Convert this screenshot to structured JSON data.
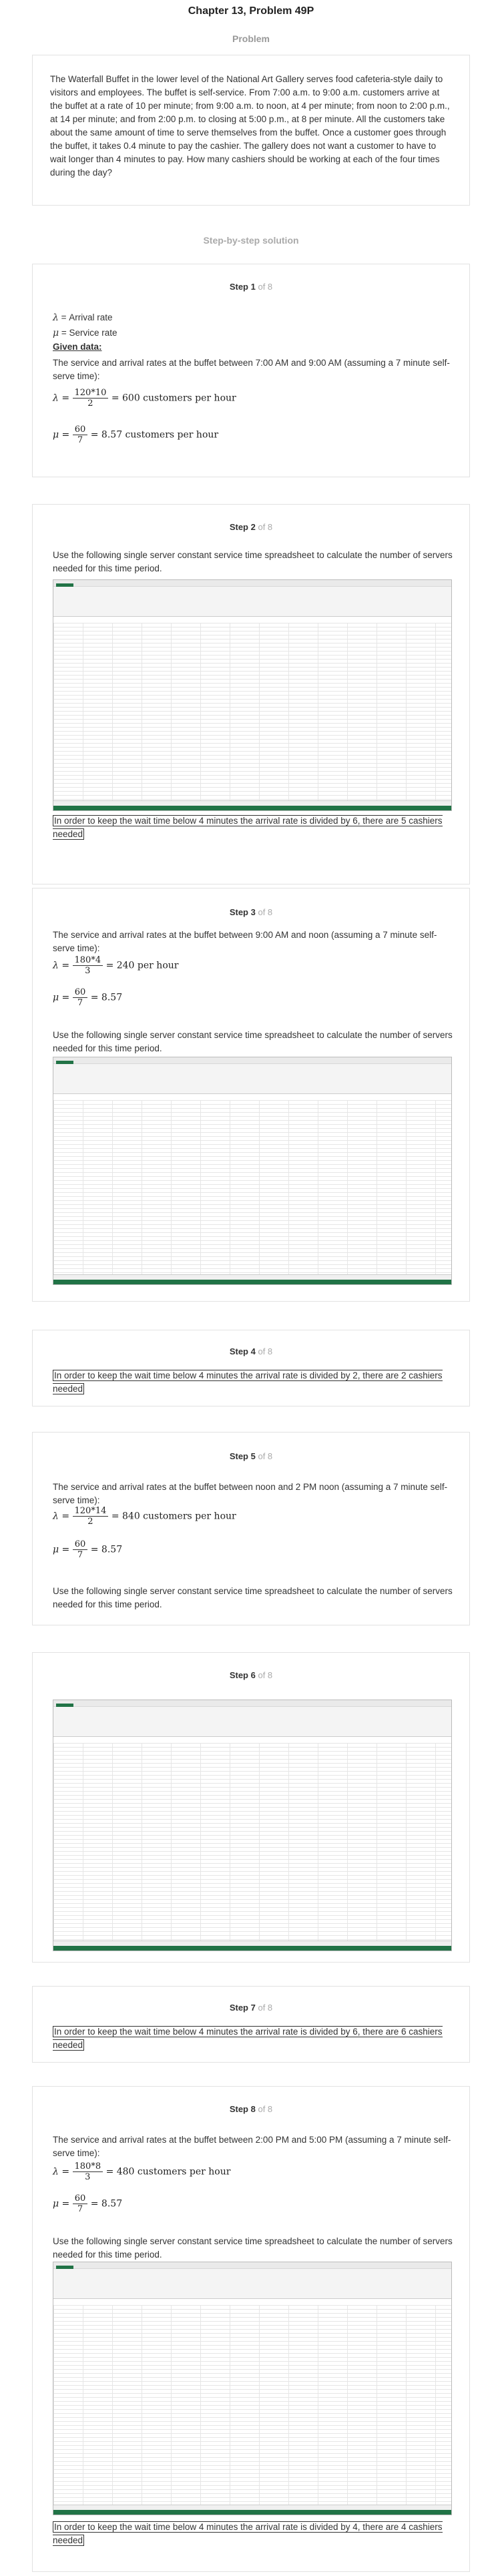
{
  "header": {
    "title": "Chapter 13, Problem 49P",
    "subtitle": "Problem"
  },
  "problem": {
    "text": "The Waterfall Buffet in the lower level of the National Art Gallery serves food cafeteria-style daily to visitors and employees. The buffet is self-service. From 7:00 a.m. to 9:00 a.m. customers arrive at the buffet at a rate of 10 per minute; from 9:00 a.m. to noon, at 4 per minute; from noon to 2:00 p.m., at 14 per minute; and from 2:00 p.m. to closing at 5:00 p.m., at 8 per minute. All the customers take about the same amount of time to serve themselves from the buffet. Once a customer goes through the buffet, it takes 0.4 minute to pay the cashier. The gallery does not want a customer to have to wait longer than 4 minutes to pay. How many cashiers should be working at each of the four times during the day?"
  },
  "solution_label": "Step-by-step solution",
  "of_label": "of 8",
  "steps": {
    "s1": {
      "label": "Step 1",
      "lambda_def": "= Arrival rate",
      "mu_def": "= Service rate",
      "given": "Given data:",
      "text": "The service and arrival rates at the buffet between 7:00 AM and 9:00 AM (assuming a 7 minute self-serve time):",
      "l_num": "120*10",
      "l_den": "2",
      "l_res": "= 600 customers per hour",
      "m_num": "60",
      "m_den": "7",
      "m_res": "= 8.57 customers per hour"
    },
    "s2": {
      "label": "Step 2",
      "text": "Use the following single server constant service time spreadsheet to calculate the number of servers needed for this time period.",
      "answer": "In order to keep the wait time below 4 minutes the arrival rate is divided by 6, there are 5 cashiers needed"
    },
    "s3": {
      "label": "Step 3",
      "text": "The service and arrival rates at the buffet between 9:00 AM and noon (assuming a 7 minute self-serve time):",
      "l_num": "180*4",
      "l_den": "3",
      "l_res": "= 240 per hour",
      "m_num": "60",
      "m_den": "7",
      "m_res": "= 8.57",
      "text2": "Use the following single server constant service time spreadsheet to calculate the number of servers needed for this time period."
    },
    "s4": {
      "label": "Step 4",
      "answer": "In order to keep the wait time below 4 minutes the arrival rate is divided by 2, there are 2 cashiers needed"
    },
    "s5": {
      "label": "Step 5",
      "text": "The service and arrival rates at the buffet between noon and 2 PM noon (assuming a 7 minute self-serve time):",
      "l_num": "120*14",
      "l_den": "2",
      "l_res": "= 840 customers per hour",
      "m_num": "60",
      "m_den": "7",
      "m_res": "= 8.57",
      "text2": "Use the following single server constant service time spreadsheet to calculate the number of servers needed for this time period."
    },
    "s6": {
      "label": "Step 6"
    },
    "s7": {
      "label": "Step 7",
      "answer": "In order to keep the wait time below 4 minutes the arrival rate is divided by 6, there are 6 cashiers needed"
    },
    "s8": {
      "label": "Step 8",
      "text": "The service and arrival rates at the buffet between 2:00 PM and 5:00 PM (assuming a 7 minute self-serve time):",
      "l_num": "180*8",
      "l_den": "3",
      "l_res": "= 480 customers per hour",
      "m_num": "60",
      "m_den": "7",
      "m_res": "= 8.57",
      "text2": "Use the following single server constant service time spreadsheet to calculate the number of servers needed for this time period.",
      "answer": "In order to keep the wait time below 4 minutes the arrival rate is divided by 4, there are 4 cashiers needed"
    }
  },
  "symbols": {
    "lambda": "λ",
    "mu": "μ"
  },
  "colors": {
    "excel_green": "#217346"
  }
}
